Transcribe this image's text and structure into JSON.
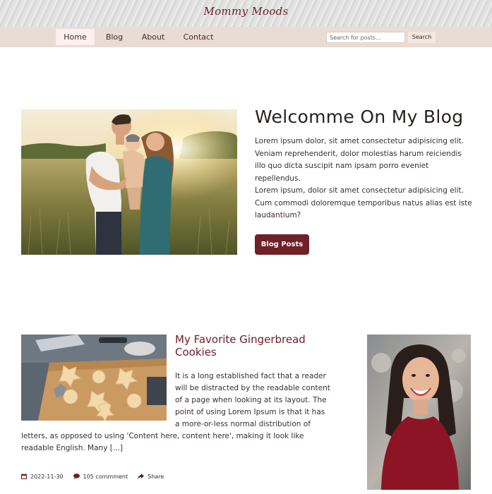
{
  "site": {
    "title": "Mommy Moods"
  },
  "nav": {
    "items": [
      {
        "label": "Home",
        "active": true
      },
      {
        "label": "Blog",
        "active": false
      },
      {
        "label": "About",
        "active": false
      },
      {
        "label": "Contact",
        "active": false
      }
    ]
  },
  "search": {
    "placeholder": "Search for posts...",
    "button_label": "Search"
  },
  "hero": {
    "title": "Welcomme On My Blog",
    "paragraph_1": "Lorem ipsum dolor, sit amet consectetur adipisicing elit. Veniam reprehenderit, dolor molestias harum reiciendis illo quo dicta suscipit nam ipsam porro eveniet repellendus.",
    "paragraph_2": "Lorem ipsum, dolor sit amet consectetur adipisicing elit. Cum commodi doloremque temporibus natus alias est iste laudantium?",
    "button_label": "Blog Posts"
  },
  "post": {
    "title": "My Favorite Gingerbread Cookies",
    "excerpt": "It is a long established fact that a reader will be distracted by the readable content of a page when looking at its layout. The point of using Lorem Ipsum is that it has a more-or-less normal distribution of letters, as opposed to using 'Content here, content here', making it look like readable English. Many [...]",
    "date": "2022-11-30",
    "comments": "105 commment",
    "share_label": "Share"
  },
  "colors": {
    "accent": "#6e2228",
    "nav_background": "#e9dcd3",
    "nav_active": "#fbeff0"
  }
}
